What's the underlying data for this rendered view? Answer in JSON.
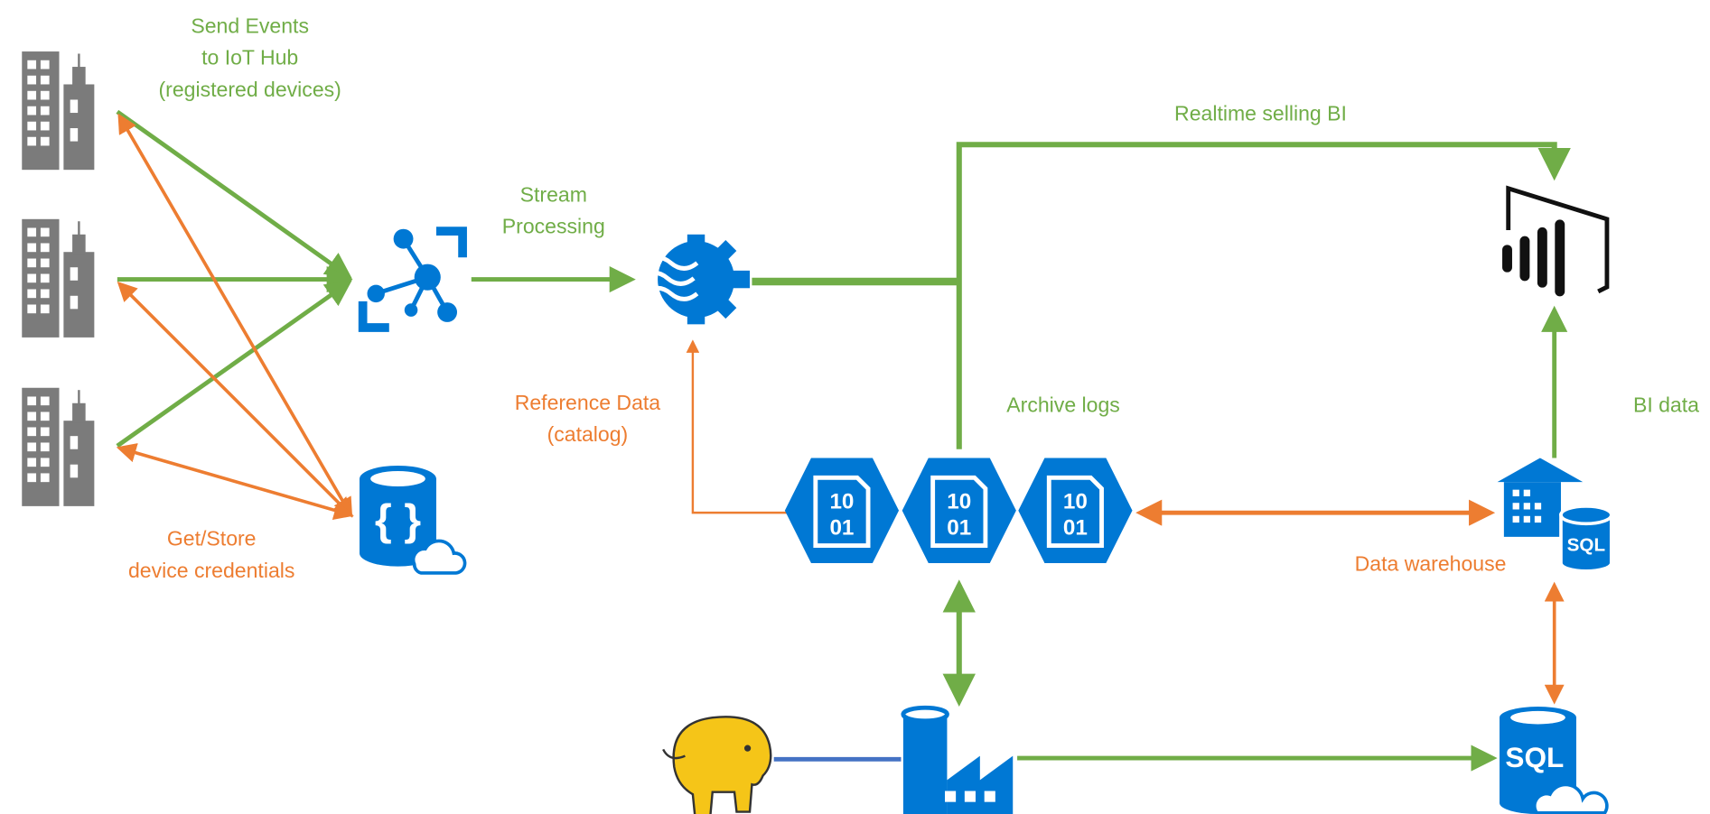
{
  "colors": {
    "green": "#70ad47",
    "orange": "#ed7d31",
    "blue": "#0078d4",
    "grey": "#7b7b7b",
    "hadoop": "#f5c518"
  },
  "labels": {
    "send_events": [
      "Send Events",
      "to IoT Hub",
      "(registered devices)"
    ],
    "stream_processing": [
      "Stream",
      "Processing"
    ],
    "realtime_bi": "Realtime selling BI",
    "archive_logs": "Archive logs",
    "bi_data": "BI data",
    "reference_data": [
      "Reference Data",
      "(catalog)"
    ],
    "get_store": [
      "Get/Store",
      "device credentials"
    ],
    "data_warehouse": "Data warehouse"
  },
  "icons": {
    "devices": [
      "building-icon",
      "building-icon",
      "building-icon"
    ],
    "iot_hub": "iot-hub-icon",
    "key_vault": "cosmos-db-icon",
    "stream_analytics": "stream-analytics-icon",
    "power_bi": "power-bi-icon",
    "data_lake": [
      "binary-blob-icon",
      "binary-blob-icon",
      "binary-blob-icon"
    ],
    "blob_text": [
      "10",
      "01"
    ],
    "warehouse": "sql-data-warehouse-icon",
    "warehouse_text": "SQL",
    "sql_db": "sql-database-icon",
    "sql_db_text": "SQL",
    "data_factory": "data-factory-icon",
    "hadoop": "hadoop-elephant-icon"
  }
}
